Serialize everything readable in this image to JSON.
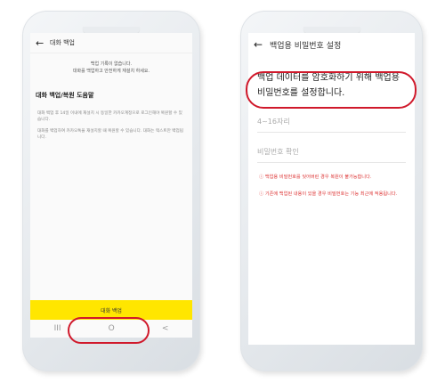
{
  "backup_screen": {
    "back_arrow": "←",
    "title": "대화 백업",
    "notice_line1": "백업 기록이 없습니다.",
    "notice_line2": "대화를 백업하고 안전하게 재설치 하세요.",
    "help_title": "대화 백업/복원 도움말",
    "help_item1": "대화 백업 후 14일 이내에 재설치 시 동일한 카카오계정으로 로그인해야 복원할 수 있습니다.",
    "help_item2": "대화를 백업하여 카카오톡을 재설치할 때 복원할 수 있습니다. 대화는 텍스트만 백업됩니다.",
    "backup_button": "대화 백업",
    "nav_recent": "III",
    "nav_home": "O",
    "nav_back": "<"
  },
  "password_screen": {
    "back_arrow": "←",
    "title": "백업용 비밀번호 설정",
    "headline_line1": "백업 데이터를 암호화하기 위해 백업용",
    "headline_line2": "비밀번호를 설정합니다.",
    "password_placeholder": "4~16자리",
    "confirm_placeholder": "비밀번호 확인",
    "warning1": "ⓘ 백업용 비밀번호를 잊어버린 경우 복원이 불가능합니다.",
    "warning2": "ⓘ 기존에 백업된 내용이 있을 경우 비밀번호는 기능 최근에 적용됩니다."
  },
  "colors": {
    "accent_yellow": "#ffe600",
    "highlight_red": "#d0192b",
    "warning_red": "#dd3333"
  }
}
